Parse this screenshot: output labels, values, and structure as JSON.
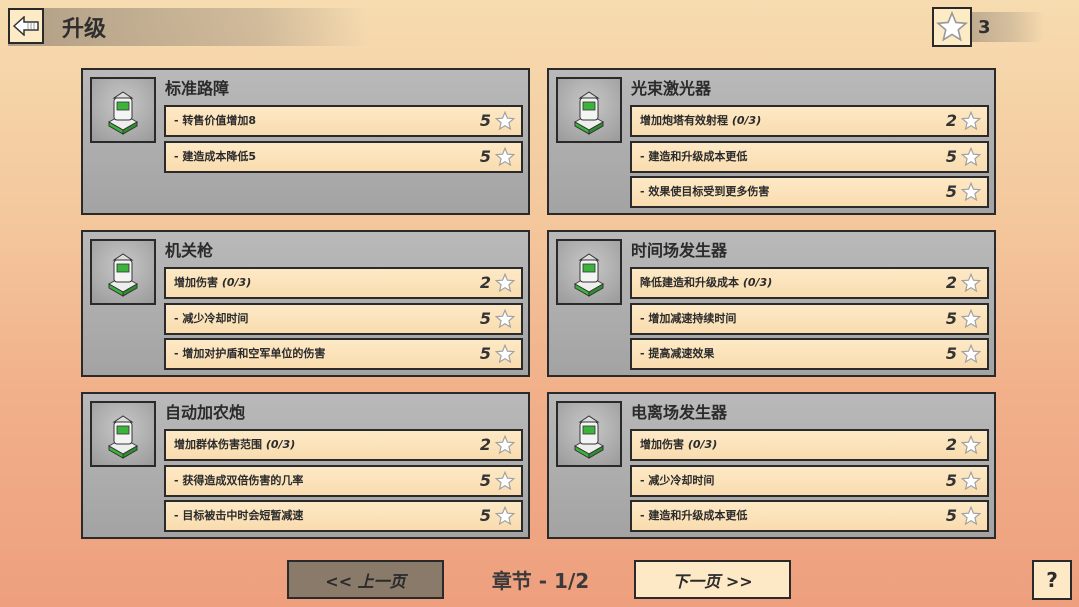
{
  "header": {
    "title": "升级",
    "star_total": "3"
  },
  "colors": {
    "star": "#ffffff",
    "star_outline": "#9a9a9a",
    "turret_green": "#3cb43c"
  },
  "panels": [
    {
      "name": "标准路障",
      "icon": "barricade-icon",
      "rows": [
        {
          "label": "- 转售价值增加8",
          "progress": "",
          "cost": "5"
        },
        {
          "label": "- 建造成本降低5",
          "progress": "",
          "cost": "5"
        }
      ]
    },
    {
      "name": "光束激光器",
      "icon": "laser-turret-icon",
      "rows": [
        {
          "label": "增加炮塔有效射程",
          "progress": "(0/3)",
          "cost": "2"
        },
        {
          "label": "- 建造和升级成本更低",
          "progress": "",
          "cost": "5"
        },
        {
          "label": "- 效果使目标受到更多伤害",
          "progress": "",
          "cost": "5"
        }
      ]
    },
    {
      "name": "机关枪",
      "icon": "machine-gun-icon",
      "rows": [
        {
          "label": "增加伤害",
          "progress": "(0/3)",
          "cost": "2"
        },
        {
          "label": "- 减少冷却时间",
          "progress": "",
          "cost": "5"
        },
        {
          "label": "- 增加对护盾和空军单位的伤害",
          "progress": "",
          "cost": "5"
        }
      ]
    },
    {
      "name": "时间场发生器",
      "icon": "time-field-icon",
      "rows": [
        {
          "label": "降低建造和升级成本",
          "progress": "(0/3)",
          "cost": "2"
        },
        {
          "label": "- 增加减速持续时间",
          "progress": "",
          "cost": "5"
        },
        {
          "label": "- 提高减速效果",
          "progress": "",
          "cost": "5"
        }
      ]
    },
    {
      "name": "自动加农炮",
      "icon": "auto-cannon-icon",
      "rows": [
        {
          "label": "增加群体伤害范围",
          "progress": "(0/3)",
          "cost": "2"
        },
        {
          "label": "- 获得造成双倍伤害的几率",
          "progress": "",
          "cost": "5"
        },
        {
          "label": "- 目标被击中时会短暂减速",
          "progress": "",
          "cost": "5"
        }
      ]
    },
    {
      "name": "电离场发生器",
      "icon": "ion-field-icon",
      "rows": [
        {
          "label": "增加伤害",
          "progress": "(0/3)",
          "cost": "2"
        },
        {
          "label": "- 减少冷却时间",
          "progress": "",
          "cost": "5"
        },
        {
          "label": "- 建造和升级成本更低",
          "progress": "",
          "cost": "5"
        }
      ]
    }
  ],
  "footer": {
    "prev_label": "<< 上一页",
    "next_label": "下一页 >>",
    "chapter": "章节 - 1/2",
    "help": "?"
  }
}
